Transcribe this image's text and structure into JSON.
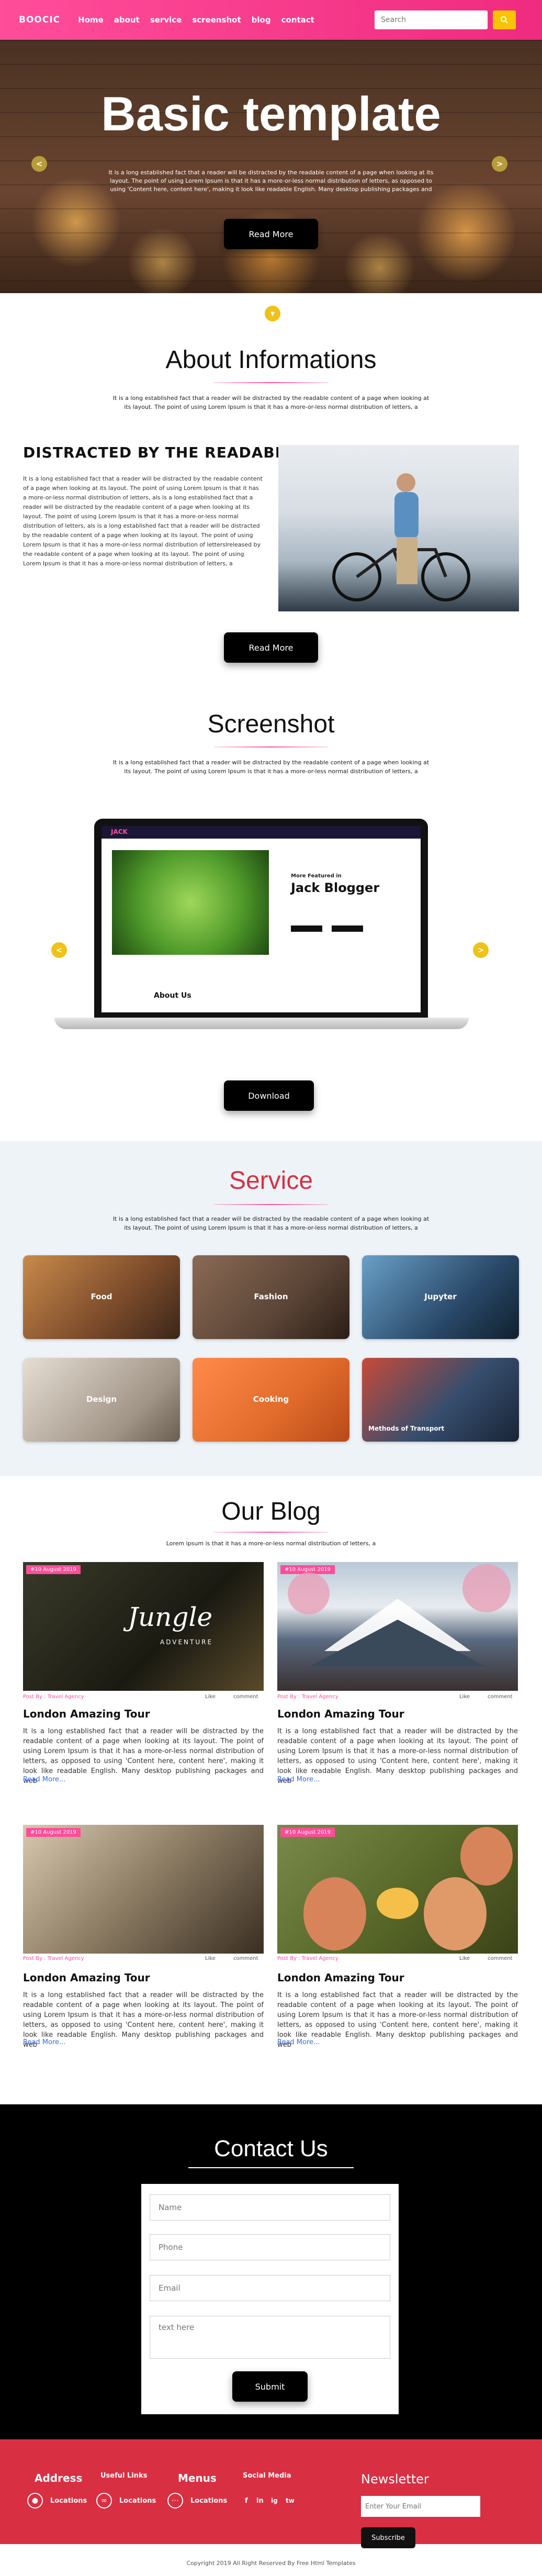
{
  "nav": {
    "brand": "BOOCIC",
    "links": [
      "Home",
      "about",
      "service",
      "screenshot",
      "blog",
      "contact"
    ],
    "search_placeholder": "Search"
  },
  "hero": {
    "title": "Basic template",
    "text": "It is a long established fact that a reader will be distracted by the readable content of a page when looking at its layout. The point of using Lorem Ipsum is that it has a more-or-less normal distribution of letters, as opposed to using 'Content here, content here', making it look like readable English. Many desktop publishing packages and",
    "button": "Read More",
    "prev_arrow": "<",
    "next_arrow": ">"
  },
  "about": {
    "title": "About Informations",
    "intro": "It is a long established fact that a reader will be distracted by the readable content of a page when looking at its layout. The point of using Lorem Ipsum is that it has a more-or-less normal distribution of letters, a",
    "subheading": "DISTRACTED BY THE READABLE",
    "body": "It is a long established fact that a reader will be distracted by the readable content of a page when looking at its layout. The point of using Lorem Ipsum is that it has a more-or-less normal distribution of letters, als is a long established fact that a reader will be distracted by the readable content of a page when looking at its layout. The point of using Lorem Ipsum is that it has a more-or-less normal distribution of letters, als is a long established fact that a reader will be distracted by the readable content of a page when looking at its layout. The point of using Lorem Ipsum is that it has a more-or-less normal distribution of letterslreleased by the readable content of a page when looking at its layout. The point of using Lorem Ipsum is that it has a more-or-less normal distribution of letters, a",
    "button": "Read More"
  },
  "screenshot": {
    "title": "Screenshot",
    "intro": "It is a long established fact that a reader will be distracted by the readable content of a page when looking at its layout. The point of using Lorem Ipsum is that it has a more-or-less normal distribution of letters, a",
    "screen_logo": "JACK",
    "screen_heading_small": "More Featured in",
    "screen_heading": "Jack Blogger",
    "screen_about": "About Us",
    "button": "Download",
    "prev_arrow": "<",
    "next_arrow": ">"
  },
  "service": {
    "title": "Service",
    "intro": "It is a long established fact that a reader will be distracted by the readable content of a page when looking at its layout. The point of using Lorem Ipsum is that it has a more-or-less normal distribution of letters, a",
    "cards": [
      {
        "label": "Food",
        "color": "#7a4a2a"
      },
      {
        "label": "Fashion",
        "color": "#5a4436"
      },
      {
        "label": "Jupyter",
        "color": "#2a4a6a"
      },
      {
        "label": "Design",
        "color": "#a09486"
      },
      {
        "label": "Cooking",
        "color": "#e06a2a"
      },
      {
        "label": "Methods of Transport",
        "color": "#364e6e"
      }
    ]
  },
  "blog": {
    "title": "Our Blog",
    "intro": "Lorem ipsum is that it has a more-or-less normal distribution of letters, a",
    "posts": [
      {
        "date": "#10 August 2019",
        "by": "Post By : Travel Agency",
        "likes": "Like",
        "comments": "comment",
        "title": "London Amazing Tour",
        "text": "It is a long established fact that a reader will be distracted by the readable content of a page when looking at its layout. The point of using Lorem Ipsum is that it has a more-or-less normal distribution of letters, as opposed to using 'Content here, content here', making it look like readable English. Many desktop publishing packages and web",
        "link": "Read More...",
        "overlay": "Jungle",
        "overlay_sub": "ADVENTURE"
      },
      {
        "date": "#10 August 2019",
        "by": "Post By : Travel Agency",
        "likes": "Like",
        "comments": "comment",
        "title": "London Amazing Tour",
        "text": "It is a long established fact that a reader will be distracted by the readable content of a page when looking at its layout. The point of using Lorem Ipsum is that it has a more-or-less normal distribution of letters, as opposed to using 'Content here, content here', making it look like readable English. Many desktop publishing packages and web",
        "link": "Read More..."
      },
      {
        "date": "#10 August 2019",
        "by": "Post By : Travel Agency",
        "likes": "Like",
        "comments": "comment",
        "title": "London Amazing Tour",
        "text": "It is a long established fact that a reader will be distracted by the readable content of a page when looking at its layout. The point of using Lorem Ipsum is that it has a more-or-less normal distribution of letters, as opposed to using 'Content here, content here', making it look like readable English. Many desktop publishing packages and web",
        "link": "Read More..."
      },
      {
        "date": "#10 August 2019",
        "by": "Post By : Travel Agency",
        "likes": "Like",
        "comments": "comment",
        "title": "London Amazing Tour",
        "text": "It is a long established fact that a reader will be distracted by the readable content of a page when looking at its layout. The point of using Lorem Ipsum is that it has a more-or-less normal distribution of letters, as opposed to using 'Content here, content here', making it look like readable English. Many desktop publishing packages and web",
        "link": "Read More..."
      }
    ]
  },
  "contact": {
    "title": "Contact Us",
    "name_placeholder": "Name",
    "phone_placeholder": "Phone",
    "email_placeholder": "Email",
    "message_placeholder": "text here",
    "button": "Submit"
  },
  "footer": {
    "address_title": "Address",
    "useful_title": "Useful Links",
    "menus_title": "Menus",
    "social_title": "Social Media",
    "location1": "Locations",
    "location2": "Locations",
    "location3": "Locations",
    "newsletter_title": "Newsletter",
    "newsletter_placeholder": "Enter Your Email",
    "subscribe": "Subscribe",
    "social_icons": [
      "f",
      "in",
      "ig",
      "tw"
    ],
    "copyright": "Copyright 2019 All Right Reserved By Free Html Templates"
  },
  "colors": {
    "accent": "#ff4d9a",
    "search_button": "#f8c400",
    "footer": "#d92f42"
  }
}
